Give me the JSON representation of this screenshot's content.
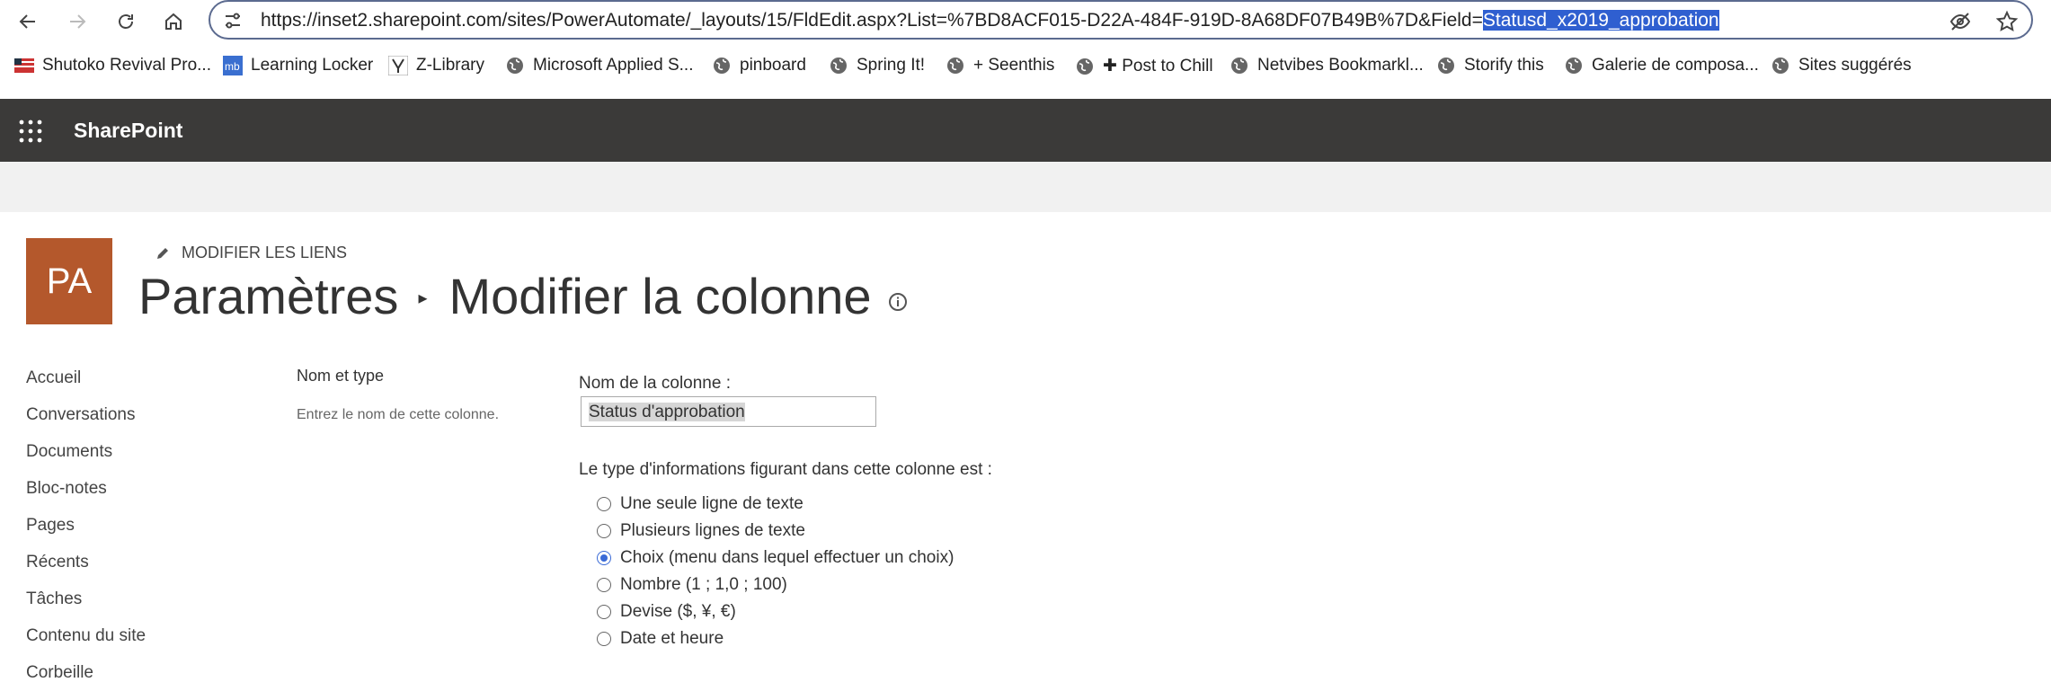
{
  "browser": {
    "url_prefix": "https://inset2.sharepoint.com/sites/PowerAutomate/_layouts/15/FldEdit.aspx?List=%7BD8ACF015-D22A-484F-919D-8A68DF07B49B%7D&Field=",
    "url_selected": "Statusd_x2019_approbation",
    "bookmarks": [
      {
        "label": "Shutoko Revival Pro...",
        "icon": "flag-icon"
      },
      {
        "label": "Learning Locker",
        "icon": "mb-icon"
      },
      {
        "label": "Z-Library",
        "icon": "zlib-icon"
      },
      {
        "label": "Microsoft Applied S...",
        "icon": "globe-icon"
      },
      {
        "label": "pinboard",
        "icon": "globe-icon"
      },
      {
        "label": "Spring It!",
        "icon": "globe-icon"
      },
      {
        "label": "+ Seenthis",
        "icon": "globe-icon"
      },
      {
        "label": "✚ Post to Chill",
        "icon": "globe-icon"
      },
      {
        "label": "Netvibes Bookmarkl...",
        "icon": "globe-icon"
      },
      {
        "label": "Storify this",
        "icon": "globe-icon"
      },
      {
        "label": "Galerie de composa...",
        "icon": "globe-icon"
      },
      {
        "label": "Sites suggérés",
        "icon": "globe-icon"
      }
    ]
  },
  "suite": {
    "title": "SharePoint"
  },
  "site": {
    "logo_text": "PA",
    "edit_links": "MODIFIER LES LIENS",
    "breadcrumb_parent": "Paramètres",
    "breadcrumb_current": "Modifier la colonne"
  },
  "leftnav": [
    "Accueil",
    "Conversations",
    "Documents",
    "Bloc-notes",
    "Pages",
    "Récents",
    "Tâches",
    "Contenu du site",
    "Corbeille"
  ],
  "form": {
    "section_title": "Nom et type",
    "section_desc": "Entrez le nom de cette colonne.",
    "column_name_label": "Nom de la colonne :",
    "column_name_value": "Status d'approbation",
    "type_label": "Le type d'informations figurant dans cette colonne est :",
    "types": [
      {
        "label": "Une seule ligne de texte",
        "checked": false
      },
      {
        "label": "Plusieurs lignes de texte",
        "checked": false
      },
      {
        "label": "Choix (menu dans lequel effectuer un choix)",
        "checked": true
      },
      {
        "label": "Nombre (1 ; 1,0 ; 100)",
        "checked": false
      },
      {
        "label": "Devise ($, ¥, €)",
        "checked": false
      },
      {
        "label": "Date et heure",
        "checked": false
      }
    ]
  },
  "colors": {
    "suitebar": "#3b3a39",
    "logo": "#b4582c",
    "radio_accent": "#3a6ad6",
    "url_highlight": "#2f5fd0"
  }
}
